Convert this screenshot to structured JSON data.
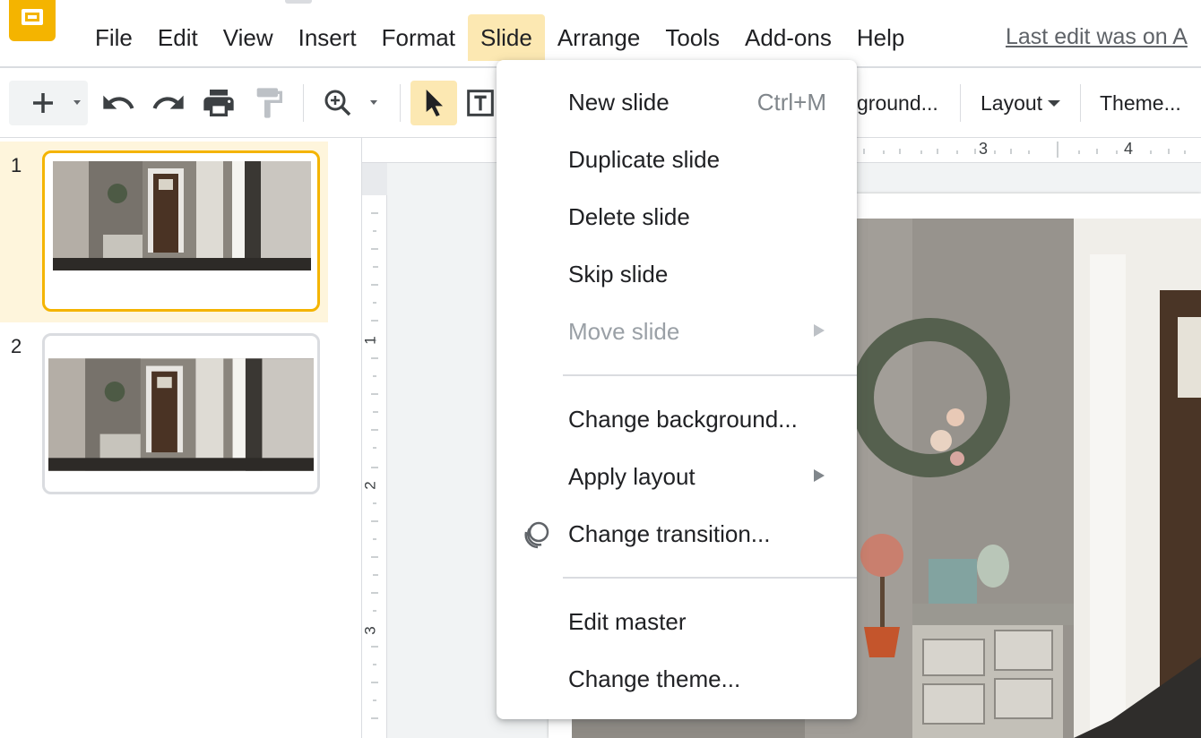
{
  "menubar": {
    "items": [
      "File",
      "Edit",
      "View",
      "Insert",
      "Format",
      "Slide",
      "Arrange",
      "Tools",
      "Add-ons",
      "Help"
    ],
    "active": "Slide",
    "last_edit": "Last edit was on A"
  },
  "toolbar": {
    "background_label": "ground...",
    "layout_label": "Layout",
    "theme_label": "Theme..."
  },
  "filmstrip": {
    "slides": [
      {
        "number": "1",
        "selected": true
      },
      {
        "number": "2",
        "selected": false
      }
    ]
  },
  "ruler": {
    "top_labels": [
      "3",
      "4"
    ],
    "left_labels": [
      "1",
      "2",
      "3"
    ]
  },
  "slide_menu": {
    "new_slide": {
      "label": "New slide",
      "shortcut": "Ctrl+M"
    },
    "duplicate_slide": "Duplicate slide",
    "delete_slide": "Delete slide",
    "skip_slide": "Skip slide",
    "move_slide": "Move slide",
    "change_background": "Change background...",
    "apply_layout": "Apply layout",
    "change_transition": "Change transition...",
    "edit_master": "Edit master",
    "change_theme": "Change theme..."
  },
  "colors": {
    "accent": "#f4b400",
    "menu_active_bg": "#fce8b2",
    "selected_thumb_bg": "#fef5dc"
  }
}
